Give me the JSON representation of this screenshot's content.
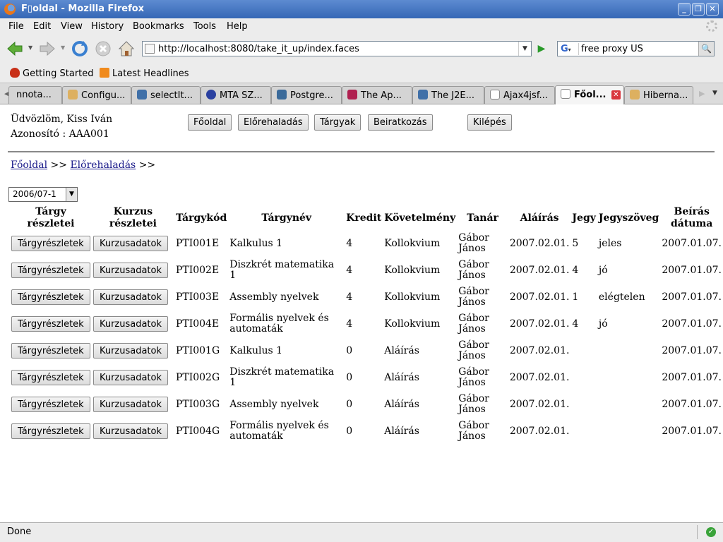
{
  "window": {
    "title": "F▯oldal - Mozilla Firefox"
  },
  "menu": [
    "File",
    "Edit",
    "View",
    "History",
    "Bookmarks",
    "Tools",
    "Help"
  ],
  "url": "http://localhost:8080/take_it_up/index.faces",
  "search": {
    "engine": "G",
    "value": "free proxy US"
  },
  "bookmarks": [
    "Getting Started",
    "Latest Headlines"
  ],
  "tabs": [
    "nnota...",
    "Configu...",
    "selectIt...",
    "MTA SZ...",
    "Postgre...",
    "The Ap...",
    "The J2E...",
    "Ajax4jsf...",
    "Főol...",
    "Hiberna..."
  ],
  "user": {
    "greeting": "Üdvözlöm, Kiss Iván",
    "id_line": "Azonosító : AAA001"
  },
  "nav_buttons": [
    "Főoldal",
    "Előrehaladás",
    "Tárgyak",
    "Beiratkozás"
  ],
  "logout": "Kilépés",
  "breadcrumb": {
    "home": "Főoldal",
    "sep": ">>",
    "current": "Előrehaladás",
    "trail": ">>"
  },
  "semester": "2006/07-1",
  "table": {
    "headers": [
      "Tárgy részletei",
      "Kurzus részletei",
      "Tárgykód",
      "Tárgynév",
      "Kredit",
      "Követelmény",
      "Tanár",
      "Aláírás",
      "Jegy",
      "Jegyszöveg",
      "Beírás dátuma"
    ],
    "button_subject": "Tárgyrészletek",
    "button_course": "Kurzusadatok",
    "rows": [
      {
        "code": "PTI001E",
        "name": "Kalkulus 1",
        "credit": "4",
        "req": "Kollokvium",
        "teacher": "Gábor János",
        "sign": "2007.02.01.",
        "grade": "5",
        "grade_text": "jeles",
        "date": "2007.01.07."
      },
      {
        "code": "PTI002E",
        "name": "Diszkrét matematika 1",
        "credit": "4",
        "req": "Kollokvium",
        "teacher": "Gábor János",
        "sign": "2007.02.01.",
        "grade": "4",
        "grade_text": "jó",
        "date": "2007.01.07."
      },
      {
        "code": "PTI003E",
        "name": "Assembly nyelvek",
        "credit": "4",
        "req": "Kollokvium",
        "teacher": "Gábor János",
        "sign": "2007.02.01.",
        "grade": "1",
        "grade_text": "elégtelen",
        "date": "2007.01.07."
      },
      {
        "code": "PTI004E",
        "name": "Formális nyelvek és automaták",
        "credit": "4",
        "req": "Kollokvium",
        "teacher": "Gábor János",
        "sign": "2007.02.01.",
        "grade": "4",
        "grade_text": "jó",
        "date": "2007.01.07."
      },
      {
        "code": "PTI001G",
        "name": "Kalkulus 1",
        "credit": "0",
        "req": "Aláírás",
        "teacher": "Gábor János",
        "sign": "2007.02.01.",
        "grade": "",
        "grade_text": "",
        "date": "2007.01.07."
      },
      {
        "code": "PTI002G",
        "name": "Diszkrét matematika 1",
        "credit": "0",
        "req": "Aláírás",
        "teacher": "Gábor János",
        "sign": "2007.02.01.",
        "grade": "",
        "grade_text": "",
        "date": "2007.01.07."
      },
      {
        "code": "PTI003G",
        "name": "Assembly nyelvek",
        "credit": "0",
        "req": "Aláírás",
        "teacher": "Gábor János",
        "sign": "2007.02.01.",
        "grade": "",
        "grade_text": "",
        "date": "2007.01.07."
      },
      {
        "code": "PTI004G",
        "name": "Formális nyelvek és automaták",
        "credit": "0",
        "req": "Aláírás",
        "teacher": "Gábor János",
        "sign": "2007.02.01.",
        "grade": "",
        "grade_text": "",
        "date": "2007.01.07."
      }
    ]
  },
  "status": "Done"
}
